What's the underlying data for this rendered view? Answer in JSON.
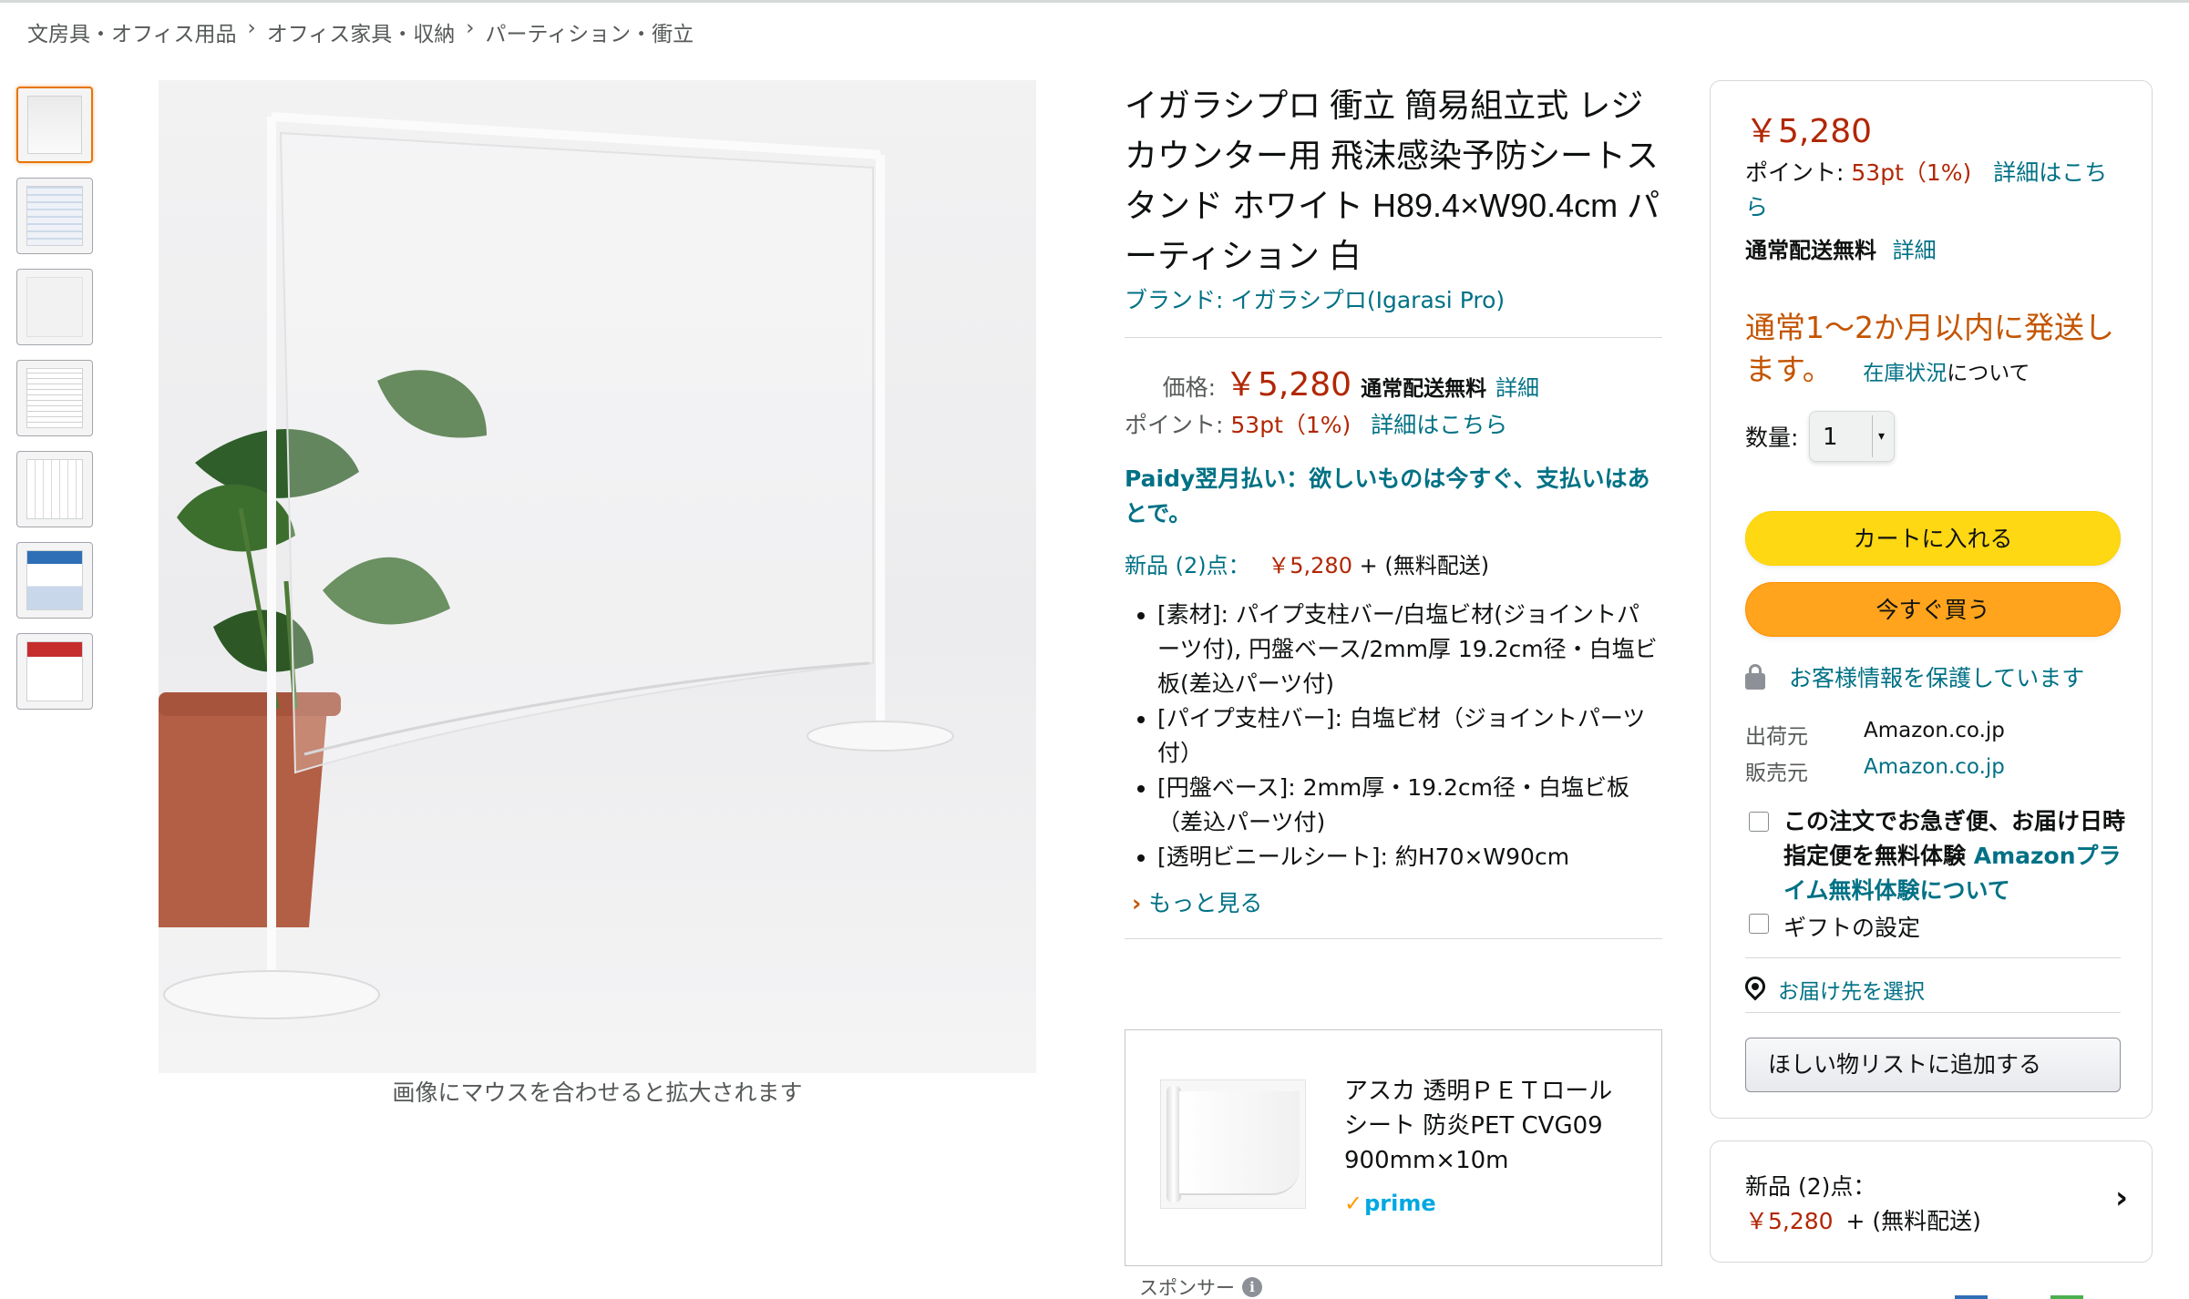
{
  "breadcrumb": {
    "items": [
      "文房具・オフィス用品",
      "オフィス家具・収納",
      "パーティション・衝立"
    ],
    "separator": "›"
  },
  "thumbnails": [
    "product-photo",
    "package-front",
    "clear-sheet",
    "spec-sheet",
    "instruction-sheet",
    "package-back",
    "promo-card"
  ],
  "main_image": {
    "hover_hint": "画像にマウスを合わせると拡大されます"
  },
  "product": {
    "title": "イガラシプロ 衝立 簡易組立式 レジカウンター用 飛沫感染予防シートスタンド ホワイト H89.4×W90.4cm パーティション 白",
    "brand": "ブランド: イガラシプロ(Igarasi Pro)",
    "price_label": "価格:",
    "price": "￥5,280",
    "shipping_free": "通常配送無料",
    "shipping_details": "詳細",
    "points_label": "ポイント:",
    "points_value": "53pt（1%)",
    "points_details": "詳細はこちら",
    "paidy": "Paidy翌月払い：欲しいものは今すぐ、支払いはあとで。",
    "new_offers_label": "新品 (2)点：",
    "new_offers_price": "￥5,280",
    "new_offers_shipping": "+ (無料配送)",
    "bullets": [
      "[素材]: パイプ支柱バー/白塩ビ材(ジョイントパーツ付), 円盤ベース/2mm厚 19.2cm径・白塩ビ板(差込パーツ付)",
      "[パイプ支柱バー]: 白塩ビ材（ジョイントパーツ付）",
      "[円盤ベース]: 2mm厚・19.2cm径・白塩ビ板（差込パーツ付)",
      "[透明ビニールシート]: 約H70×W90cm"
    ],
    "see_more": "もっと見る"
  },
  "sponsored": {
    "title": "アスカ 透明ＰＥＴロールシート 防炎PET CVG09 900mm×10m",
    "prime": "prime",
    "label": "スポンサー"
  },
  "buybox": {
    "price": "￥5,280",
    "points_label": "ポイント:",
    "points_value": "53pt（1%)",
    "points_details": "詳細はこちら",
    "shipping_free": "通常配送無料",
    "shipping_details": "詳細",
    "availability": "通常1～2か月以内に発送します。",
    "stock_link": "在庫状況",
    "stock_suffix": "について",
    "qty_label": "数量:",
    "qty_value": "1",
    "add_to_cart": "カートに入れる",
    "buy_now": "今すぐ買う",
    "secure": "お客様情報を保護しています",
    "ships_from_label": "出荷元",
    "ships_from": "Amazon.co.jp",
    "sold_by_label": "販売元",
    "sold_by": "Amazon.co.jp",
    "prime_offer_text": "この注文でお急ぎ便、お届け日時指定便を無料体験",
    "prime_offer_link": "Amazonプライム無料体験について",
    "gift": "ギフトの設定",
    "deliver_to": "お届け先を選択",
    "wishlist": "ほしい物リストに追加する"
  },
  "offers_box": {
    "line1": "新品 (2)点：",
    "price": "￥5,280",
    "shipping": "+ (無料配送)"
  },
  "colors": {
    "price_red": "#b12704",
    "link_teal": "#007185",
    "cart_yellow": "#ffd814",
    "buy_orange": "#ffa41c",
    "availability_orange": "#c45500"
  }
}
